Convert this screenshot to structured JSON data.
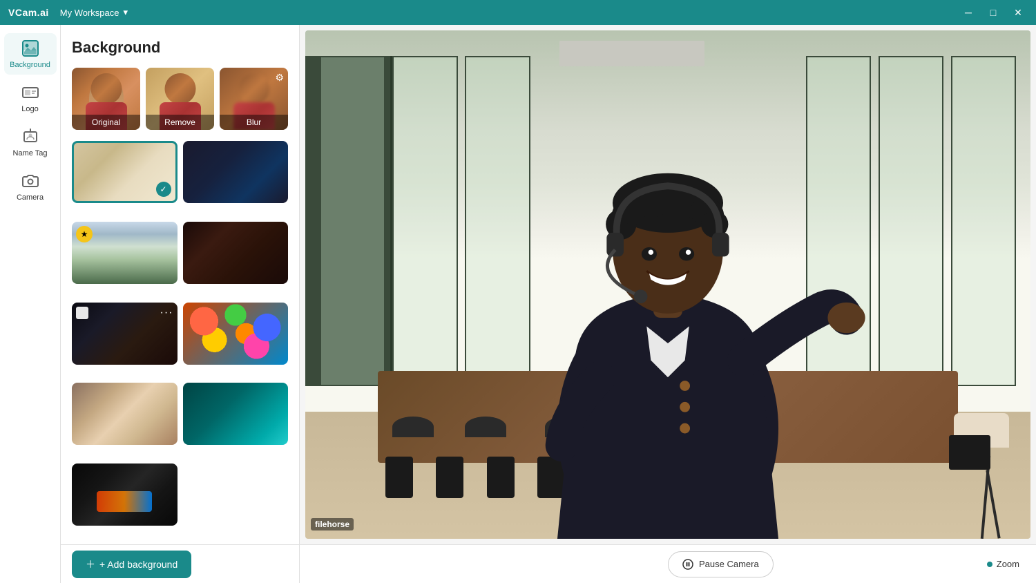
{
  "app": {
    "name": "VCam.ai",
    "workspace": "My Workspace",
    "title_bar_bg": "#1a8a8a"
  },
  "sidebar": {
    "items": [
      {
        "id": "background",
        "label": "Background",
        "active": true
      },
      {
        "id": "logo",
        "label": "Logo",
        "active": false
      },
      {
        "id": "nametag",
        "label": "Name Tag",
        "active": false
      },
      {
        "id": "camera",
        "label": "Camera",
        "active": false
      }
    ]
  },
  "panel": {
    "title": "Background",
    "presets": [
      {
        "id": "original",
        "label": "Original"
      },
      {
        "id": "remove",
        "label": "Remove"
      },
      {
        "id": "blur",
        "label": "Blur"
      }
    ],
    "backgrounds": [
      {
        "id": "bg1",
        "type": "office-light",
        "selected": true
      },
      {
        "id": "bg2",
        "type": "office-dark",
        "selected": false
      },
      {
        "id": "bg3",
        "type": "plant-room",
        "selected": false,
        "star": true
      },
      {
        "id": "bg4",
        "type": "dark-interior",
        "selected": false
      },
      {
        "id": "bg5",
        "type": "dark-minimal",
        "selected": false
      },
      {
        "id": "bg6",
        "type": "colorful-balls",
        "selected": false
      },
      {
        "id": "bg7",
        "type": "living-room",
        "selected": false
      },
      {
        "id": "bg8",
        "type": "abstract-teal",
        "selected": false
      },
      {
        "id": "bg9",
        "type": "laptop-dark",
        "selected": false
      }
    ],
    "add_button_label": "+ Add background"
  },
  "preview": {
    "pause_button_label": "Pause Camera",
    "zoom_label": "Zoom",
    "zoom_active": true
  },
  "controls": {
    "minimize": "─",
    "maximize": "□",
    "close": "✕"
  }
}
